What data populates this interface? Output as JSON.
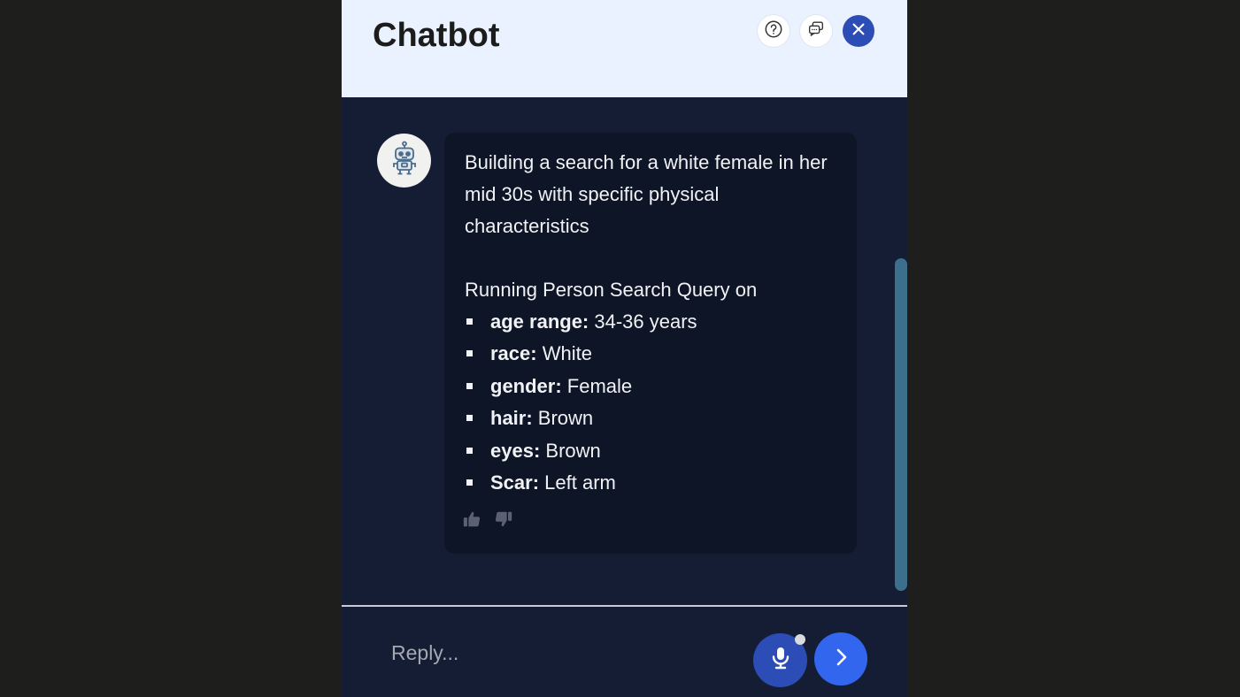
{
  "header": {
    "title": "Chatbot",
    "buttons": [
      {
        "icon": "help-icon"
      },
      {
        "icon": "chat-history-icon"
      },
      {
        "icon": "close-icon"
      }
    ]
  },
  "message": {
    "sender_icon": "robot-icon",
    "intro": "Building a search for a white female in her mid 30s with specific physical characteristics",
    "query_label": "Running Person Search Query on",
    "criteria": [
      {
        "key": "age range:",
        "value": " 34-36 years"
      },
      {
        "key": "race:",
        "value": " White"
      },
      {
        "key": "gender:",
        "value": " Female"
      },
      {
        "key": "hair:",
        "value": " Brown"
      },
      {
        "key": "eyes:",
        "value": " Brown"
      },
      {
        "key": "Scar:",
        "value": " Left arm"
      }
    ],
    "feedback_icons": [
      "thumbs-up-icon",
      "thumbs-down-icon"
    ]
  },
  "composer": {
    "placeholder": "Reply...",
    "value": ""
  },
  "colors": {
    "page_bg": "#1e1f1d",
    "panel_bg": "#141d33",
    "header_bg": "#e9f2fe",
    "bubble_bg": "#0d1527",
    "accent_dark": "#2c4db5",
    "accent": "#3366ee",
    "scrollbar": "#3b6f8c"
  }
}
